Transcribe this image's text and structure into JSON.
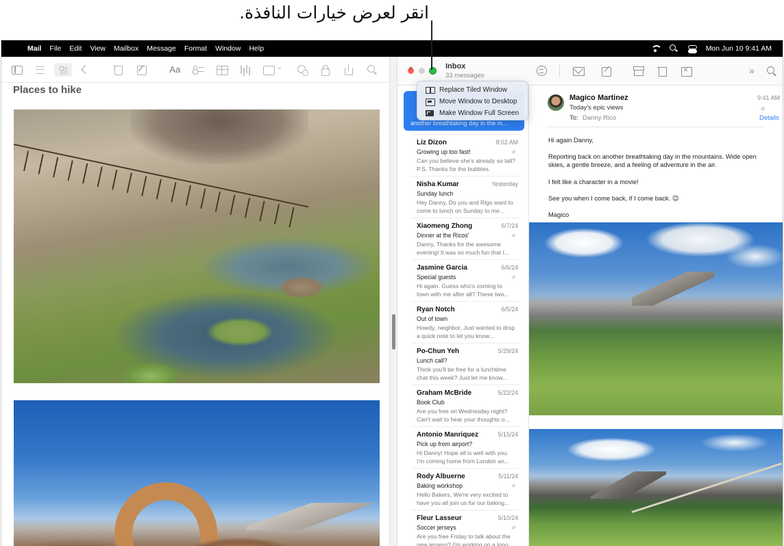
{
  "callout": {
    "text": "انقر لعرض خيارات النافذة."
  },
  "menubar": {
    "apple_icon": "apple-logo-icon",
    "app_name": "Mail",
    "menus": [
      "File",
      "Edit",
      "View",
      "Mailbox",
      "Message",
      "Format",
      "Window",
      "Help"
    ],
    "clock": "Mon Jun 10  9:41 AM",
    "status_icons": [
      "wifi-icon",
      "search-icon",
      "control-center-icon"
    ]
  },
  "notes": {
    "title": "Places to hike",
    "toolbar_text_icon": "Aa"
  },
  "mail": {
    "mailbox_title": "Inbox",
    "message_count": "33 messages",
    "window_menu": [
      {
        "label": "Replace Tiled Window",
        "icon": "tile-window-icon"
      },
      {
        "label": "Move Window to Desktop",
        "icon": "desktop-window-icon"
      },
      {
        "label": "Make Window Full Screen",
        "icon": "full-screen-icon"
      }
    ],
    "selected_preview": "another breathtaking day in the m...",
    "messages": [
      {
        "from": "Liz Dizon",
        "date": "8:02 AM",
        "subject": "Growing up too fast!",
        "preview": "Can you believe she's already so tall? P.S. Thanks for the bubbles.",
        "attachment": true
      },
      {
        "from": "Nisha Kumar",
        "date": "Yesterday",
        "subject": "Sunday lunch",
        "preview": "Hey Danny, Do you and Rigo want to come to lunch on Sunday to me...",
        "attachment": false
      },
      {
        "from": "Xiaomeng Zhong",
        "date": "6/7/24",
        "subject": "Dinner at the Ricos'",
        "preview": "Danny, Thanks for the awesome evening! It was so much fun that I...",
        "attachment": true
      },
      {
        "from": "Jasmine Garcia",
        "date": "6/6/24",
        "subject": "Special guests",
        "preview": "Hi again. Guess who's coming to town with me after all? These two...",
        "attachment": true
      },
      {
        "from": "Ryan Notch",
        "date": "6/5/24",
        "subject": "Out of town",
        "preview": "Howdy, neighbor, Just wanted to drop a quick note to let you know...",
        "attachment": false
      },
      {
        "from": "Po-Chun Yeh",
        "date": "5/29/24",
        "subject": "Lunch call?",
        "preview": "Think you'll be free for a lunchtime chat this week? Just let me know...",
        "attachment": false
      },
      {
        "from": "Graham McBride",
        "date": "5/22/24",
        "subject": "Book Club",
        "preview": "Are you free on Wednesday night? Can't wait to hear your thoughts o...",
        "attachment": false
      },
      {
        "from": "Antonio Manriquez",
        "date": "5/15/24",
        "subject": "Pick up from airport?",
        "preview": "Hi Danny! Hope all is well with you. I'm coming home from London an...",
        "attachment": false
      },
      {
        "from": "Rody Albuerne",
        "date": "5/11/24",
        "subject": "Baking workshop",
        "preview": "Hello Bakers, We're very excited to have you all join us for our baking...",
        "attachment": true
      },
      {
        "from": "Fleur Lasseur",
        "date": "5/10/24",
        "subject": "Soccer jerseys",
        "preview": "Are you free Friday to talk about the new jerseys? I'm working on a logo...",
        "attachment": true
      }
    ],
    "reader": {
      "from": "Magico Martinez",
      "subject": "Today's epic views",
      "to_label": "To:",
      "to": "Danny Rico",
      "time": "9:41 AM",
      "details_label": "Details",
      "body": [
        "Hi again Danny,",
        "Reporting back on another breathtaking day in the mountains. Wide open skies, a gentle breeze, and a feeling of adventure in the air.",
        "I felt like a character in a movie!",
        "See you when I come back, if I come back. 😉",
        "Magico"
      ]
    }
  },
  "colors": {
    "accent": "#2d7ff1",
    "close": "#ff5f57",
    "zoom": "#2ac04a",
    "menubar": "#000000"
  }
}
